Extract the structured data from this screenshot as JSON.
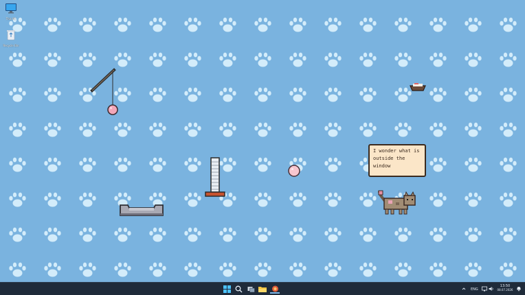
{
  "desktop": {
    "icons": [
      {
        "label": "This PC",
        "icon": "monitor-icon"
      },
      {
        "label": "Recycle Bin",
        "icon": "recycle-bin-icon"
      }
    ]
  },
  "pet": {
    "speech": "I wonder what is outside the window"
  },
  "taskbar": {
    "language": "ENG",
    "time": "13:50",
    "date": "08.07.2026",
    "apps": [
      "start-icon",
      "search-icon",
      "task-view-icon",
      "file-explorer-icon",
      "desktop-pet-app-icon"
    ]
  },
  "colors": {
    "wallpaper": "#7ab3df",
    "paw": "#d3ecfa",
    "taskbar": "#1f2b3a",
    "bubble": "#fbe6c8"
  }
}
